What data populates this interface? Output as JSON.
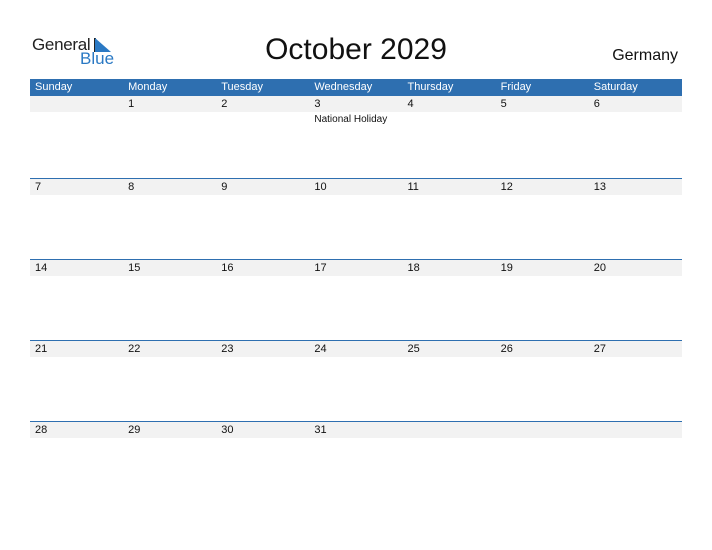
{
  "logo": {
    "general": "General",
    "blue": "Blue"
  },
  "title": "October 2029",
  "country": "Germany",
  "weekdays": [
    "Sunday",
    "Monday",
    "Tuesday",
    "Wednesday",
    "Thursday",
    "Friday",
    "Saturday"
  ],
  "weeks": [
    {
      "dates": [
        "",
        "1",
        "2",
        "3",
        "4",
        "5",
        "6"
      ],
      "events": [
        "",
        "",
        "",
        "National Holiday",
        "",
        "",
        ""
      ]
    },
    {
      "dates": [
        "7",
        "8",
        "9",
        "10",
        "11",
        "12",
        "13"
      ],
      "events": [
        "",
        "",
        "",
        "",
        "",
        "",
        ""
      ]
    },
    {
      "dates": [
        "14",
        "15",
        "16",
        "17",
        "18",
        "19",
        "20"
      ],
      "events": [
        "",
        "",
        "",
        "",
        "",
        "",
        ""
      ]
    },
    {
      "dates": [
        "21",
        "22",
        "23",
        "24",
        "25",
        "26",
        "27"
      ],
      "events": [
        "",
        "",
        "",
        "",
        "",
        "",
        ""
      ]
    },
    {
      "dates": [
        "28",
        "29",
        "30",
        "31",
        "",
        "",
        ""
      ],
      "events": [
        "",
        "",
        "",
        "",
        "",
        "",
        ""
      ]
    }
  ],
  "colors": {
    "header": "#2e6fb0",
    "date_strip": "#f2f2f2",
    "accent": "#2a79c4"
  }
}
